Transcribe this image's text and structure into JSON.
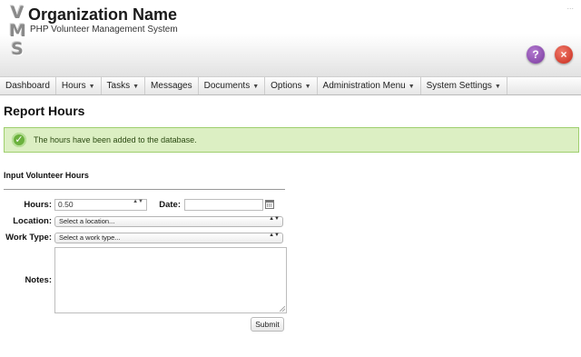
{
  "header": {
    "logo_letters": [
      "V",
      "M",
      "S"
    ],
    "org_name": "Organization Name",
    "subtitle": "PHP Volunteer Management System",
    "top_link": "...",
    "help_symbol": "?",
    "close_symbol": "×",
    "icons": [
      "help-icon",
      "close-icon"
    ]
  },
  "nav": {
    "items": [
      {
        "label": "Dashboard",
        "dropdown": false
      },
      {
        "label": "Hours",
        "dropdown": true
      },
      {
        "label": "Tasks",
        "dropdown": true
      },
      {
        "label": "Messages",
        "dropdown": false
      },
      {
        "label": "Documents",
        "dropdown": true
      },
      {
        "label": "Options",
        "dropdown": true
      },
      {
        "label": "Administration Menu",
        "dropdown": true
      },
      {
        "label": "System Settings",
        "dropdown": true
      }
    ],
    "caret": "▼"
  },
  "page": {
    "title": "Report Hours"
  },
  "alert": {
    "message": "The hours have been added to the database.",
    "icon": "checkmark-icon",
    "symbol": "✓"
  },
  "form": {
    "section_title": "Input Volunteer Hours",
    "hours_label": "Hours:",
    "hours_value": "0.50",
    "date_label": "Date:",
    "date_value": "",
    "location_label": "Location:",
    "location_value": "Select a location...",
    "work_type_label": "Work Type:",
    "work_type_value": "Select a work type...",
    "notes_label": "Notes:",
    "notes_value": "",
    "submit_label": "Submit",
    "select_arrows": "▲▼"
  },
  "colors": {
    "success_bg": "#dcefc3",
    "success_border": "#9fcf6e",
    "help_button": "#7a3a9e",
    "close_button": "#c8281a"
  }
}
